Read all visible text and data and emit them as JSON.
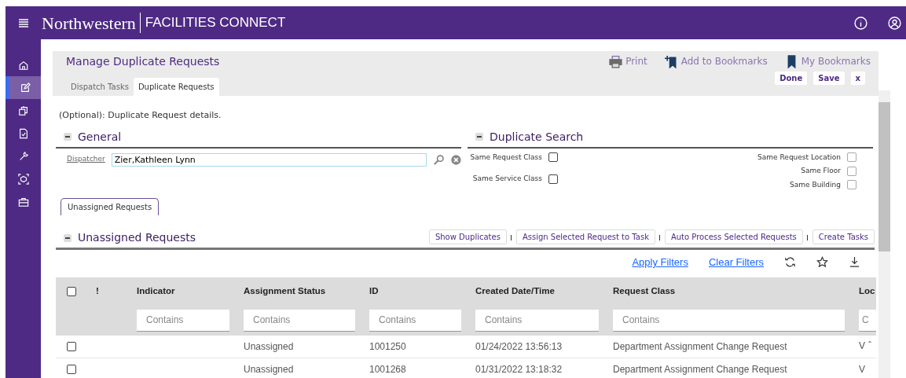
{
  "topbar": {
    "brand": "Northwestern",
    "product": "FACILITIES CONNECT"
  },
  "sidebar": {
    "items": [
      {
        "selected": false
      },
      {
        "selected": true
      },
      {
        "selected": false
      },
      {
        "selected": false
      },
      {
        "selected": false
      },
      {
        "selected": false
      },
      {
        "selected": false
      }
    ]
  },
  "page": {
    "title": "Manage Duplicate Requests",
    "actions": [
      "Print",
      "Add to Bookmarks",
      "My Bookmarks"
    ],
    "tabs": [
      {
        "label": "Dispatch Tasks",
        "selected": false
      },
      {
        "label": "Duplicate Requests",
        "selected": true
      }
    ],
    "buttons": [
      "Done",
      "Save",
      "x"
    ]
  },
  "intro": "(Optional): Duplicate Request details.",
  "general": {
    "title": "General",
    "field_label": "Dispatcher",
    "value": "Zier,Kathleen Lynn"
  },
  "duplicate_search": {
    "title": "Duplicate Search",
    "left": [
      {
        "label": "Same Request Class",
        "checked": false
      },
      {
        "label": "Same Service Class",
        "checked": false
      }
    ],
    "right": [
      {
        "label": "Same Request Location",
        "checked": false,
        "disabled": true
      },
      {
        "label": "Same Floor",
        "checked": false,
        "disabled": true
      },
      {
        "label": "Same Building",
        "checked": false,
        "disabled": true
      }
    ]
  },
  "subtabs": [
    {
      "label": "Unassigned Requests",
      "selected": true
    }
  ],
  "unassigned": {
    "title": "Unassigned Requests",
    "buttons": [
      "Show Duplicates",
      "Assign Selected Request to Task",
      "Auto Process Selected Requests",
      "Create Tasks"
    ],
    "filter_links": [
      "Apply Filters",
      "Clear Filters"
    ]
  },
  "table": {
    "select_all_checked": false,
    "columns": [
      {
        "label": "!"
      },
      {
        "label": "Indicator",
        "placeholder": "Contains"
      },
      {
        "label": "Assignment Status",
        "placeholder": "Contains"
      },
      {
        "label": "ID",
        "placeholder": "Contains"
      },
      {
        "label": "Created Date/Time",
        "placeholder": "Contains"
      },
      {
        "label": "Request Class",
        "placeholder": "Contains"
      },
      {
        "label": "Loc",
        "placeholder": "C"
      }
    ],
    "rows": [
      {
        "checked": false,
        "cells": [
          "",
          "",
          "Unassigned",
          "1001250",
          "01/24/2022 13:56:13",
          "Department Assignment Change Request",
          "V"
        ]
      },
      {
        "checked": false,
        "cells": [
          "",
          "",
          "Unassigned",
          "1001268",
          "01/31/2022 13:18:32",
          "Department Assignment Change Request",
          "V"
        ]
      }
    ]
  }
}
